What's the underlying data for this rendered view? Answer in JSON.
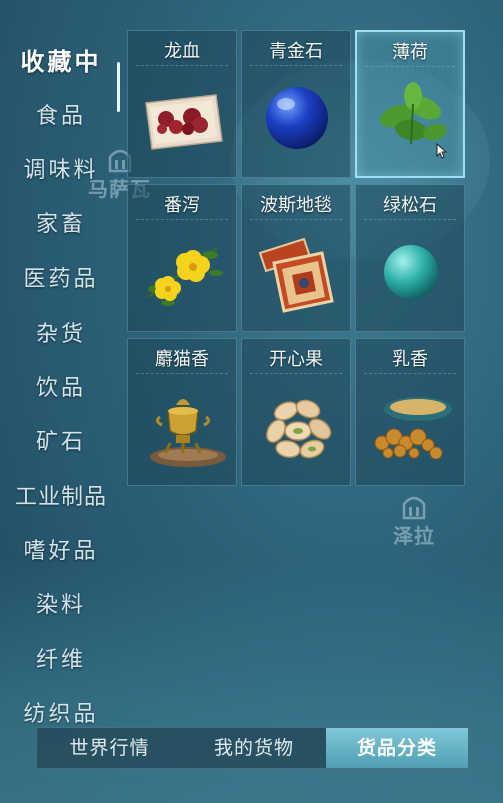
{
  "map": {
    "markers": [
      {
        "name": "马萨瓦"
      },
      {
        "name": "泽拉"
      }
    ]
  },
  "sidebar": {
    "categories": [
      {
        "label": "收藏中",
        "active": true
      },
      {
        "label": "食品"
      },
      {
        "label": "调味料"
      },
      {
        "label": "家畜"
      },
      {
        "label": "医药品"
      },
      {
        "label": "杂货"
      },
      {
        "label": "饮品"
      },
      {
        "label": "矿石"
      },
      {
        "label": "工业制品"
      },
      {
        "label": "嗜好品"
      },
      {
        "label": "染料"
      },
      {
        "label": "纤维"
      },
      {
        "label": "纺织品"
      }
    ]
  },
  "goods": [
    {
      "name": "龙血",
      "icon": "dragon-blood-icon"
    },
    {
      "name": "青金石",
      "icon": "lapis-lazuli-icon"
    },
    {
      "name": "薄荷",
      "icon": "mint-icon",
      "selected": true
    },
    {
      "name": "番泻",
      "icon": "senna-icon"
    },
    {
      "name": "波斯地毯",
      "icon": "persian-rug-icon"
    },
    {
      "name": "绿松石",
      "icon": "turquoise-icon"
    },
    {
      "name": "麝猫香",
      "icon": "civet-incense-icon"
    },
    {
      "name": "开心果",
      "icon": "pistachio-icon"
    },
    {
      "name": "乳香",
      "icon": "frankincense-icon"
    }
  ],
  "tabs": [
    {
      "label": "世界行情"
    },
    {
      "label": "我的货物"
    },
    {
      "label": "货品分类",
      "active": true
    }
  ],
  "colors": {
    "accent": "#7fc8d8",
    "selected_border": "#9fe0ee",
    "background": "#2c6178"
  }
}
